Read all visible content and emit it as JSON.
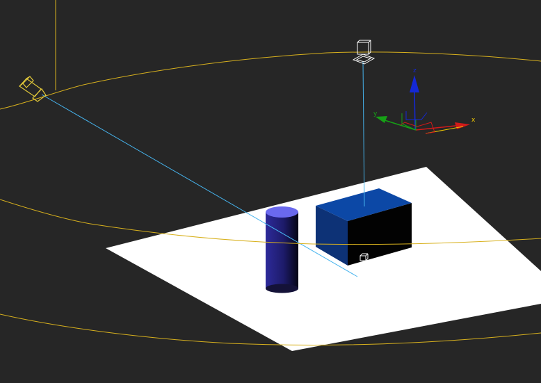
{
  "viewport": {
    "background": "#262626",
    "colors": {
      "spline": "#d8b11e",
      "light_line": "#46b4ee",
      "plane": "#ffffff",
      "box_front": "#0d3276",
      "box_top": "#0c48a6",
      "cylinder_top": "#6a69ee",
      "cylinder_body": "#2c2a8c",
      "axis_x": "#d11a1a",
      "axis_y": "#16a016",
      "axis_z": "#1428d6",
      "gizmo_outline": "#ffffff"
    }
  },
  "transform_gizmo": {
    "x_label": "x",
    "y_label": "y",
    "z_label": "z",
    "x_label_color": "#f0c800",
    "y_label_color": "#16a016",
    "z_label_color": "#1428d6"
  },
  "icons": {
    "spot_light": "spotlight-icon",
    "target_light": "target-light-icon",
    "light_target": "light-target-icon"
  }
}
